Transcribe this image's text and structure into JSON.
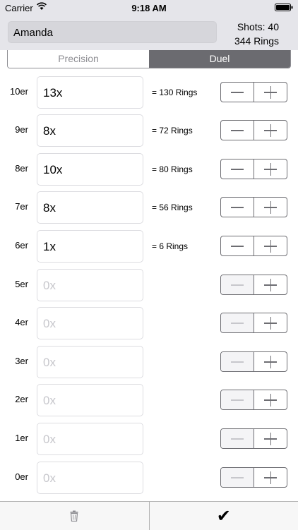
{
  "status_bar": {
    "carrier": "Carrier",
    "time": "9:18 AM"
  },
  "header": {
    "name_value": "Amanda",
    "shots_text": "Shots: 40",
    "rings_text": "344 Rings"
  },
  "segments": [
    {
      "label": "Precision",
      "selected": false
    },
    {
      "label": "Duel",
      "selected": true
    }
  ],
  "rows": [
    {
      "label": "10er",
      "value": "13x",
      "placeholder": "0x",
      "result": "= 130 Rings"
    },
    {
      "label": "9er",
      "value": "8x",
      "placeholder": "0x",
      "result": "= 72 Rings"
    },
    {
      "label": "8er",
      "value": "10x",
      "placeholder": "0x",
      "result": "= 80 Rings"
    },
    {
      "label": "7er",
      "value": "8x",
      "placeholder": "0x",
      "result": "= 56 Rings"
    },
    {
      "label": "6er",
      "value": "1x",
      "placeholder": "0x",
      "result": "= 6 Rings"
    },
    {
      "label": "5er",
      "value": "",
      "placeholder": "0x",
      "result": ""
    },
    {
      "label": "4er",
      "value": "",
      "placeholder": "0x",
      "result": ""
    },
    {
      "label": "3er",
      "value": "",
      "placeholder": "0x",
      "result": ""
    },
    {
      "label": "2er",
      "value": "",
      "placeholder": "0x",
      "result": ""
    },
    {
      "label": "1er",
      "value": "",
      "placeholder": "0x",
      "result": ""
    },
    {
      "label": "0er",
      "value": "",
      "placeholder": "0x",
      "result": ""
    }
  ],
  "toolbar": {
    "delete_icon": "trash-icon",
    "confirm_label": "✔"
  },
  "colors": {
    "header_bg": "#e5e5ea",
    "selected_segment": "#6b6b70",
    "placeholder": "#c7c7cc"
  }
}
